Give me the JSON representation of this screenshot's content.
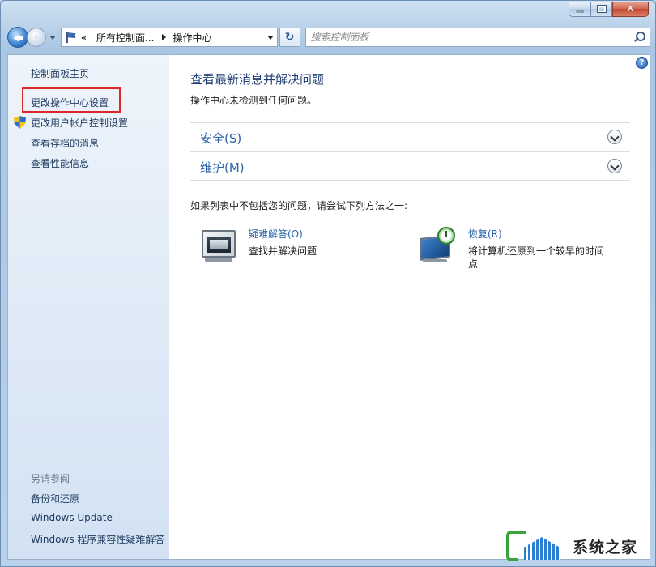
{
  "window": {
    "caption": {
      "minimize": "",
      "maximize": "",
      "close": "✕"
    }
  },
  "navbar": {
    "address_chevrons": "«",
    "address_crumb_1": "所有控制面...",
    "address_crumb_2": "操作中心",
    "refresh_glyph": "↻",
    "search_placeholder": "搜索控制面板"
  },
  "sidebar": {
    "home": "控制面板主页",
    "change_settings": "更改操作中心设置",
    "change_uac": "更改用户帐户控制设置",
    "archived_messages": "查看存档的消息",
    "performance_info": "查看性能信息",
    "see_also": "另请参阅",
    "backup_restore": "备份和还原",
    "windows_update": "Windows Update",
    "compat_troubleshooter": "Windows 程序兼容性疑难解答"
  },
  "main": {
    "help": "?",
    "title": "查看最新消息并解决问题",
    "subtitle": "操作中心未检测到任何问题。",
    "sections": [
      {
        "label": "安全(S)"
      },
      {
        "label": "维护(M)"
      }
    ],
    "try_text": "如果列表中不包括您的问题，请尝试下列方法之一:",
    "tasks": [
      {
        "link": "疑难解答(O)",
        "desc": "查找并解决问题"
      },
      {
        "link": "恢复(R)",
        "desc": "将计算机还原到一个较早的时间点"
      }
    ]
  },
  "watermark": {
    "text": "系统之家"
  },
  "colors": {
    "accent_link": "#2a63a8",
    "title_blue": "#1e3d73",
    "highlight_red": "#e0262d",
    "sidebar_bg": "#dde9f6"
  },
  "icons": [
    "back-icon",
    "forward-icon",
    "flag-icon",
    "refresh-icon",
    "search-icon",
    "shield-icon",
    "help-icon",
    "chevron-down-icon",
    "troubleshooting-icon",
    "recovery-icon"
  ]
}
